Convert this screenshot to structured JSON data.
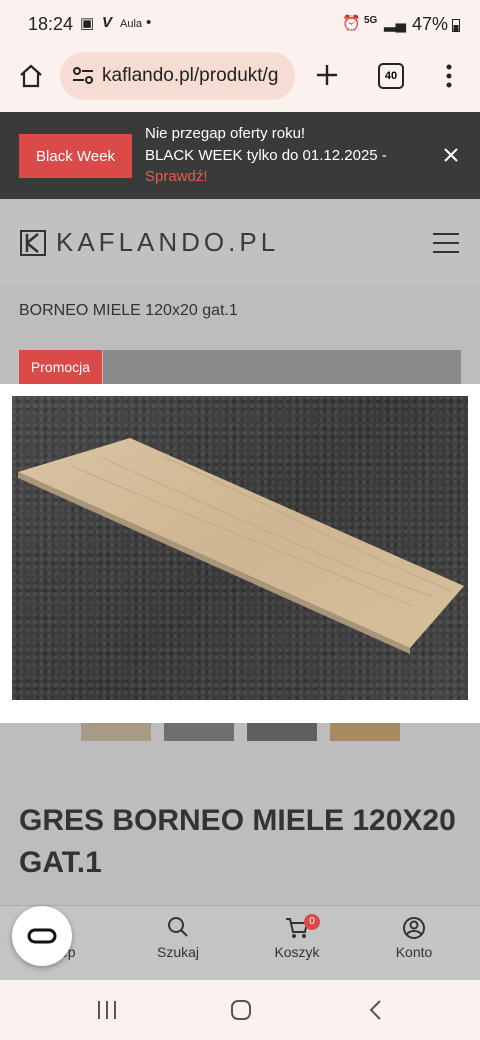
{
  "status_bar": {
    "time": "18:24",
    "network": "5G",
    "battery": "47%"
  },
  "browser": {
    "url": "kaflando.pl/produkt/g",
    "tab_count": "40"
  },
  "banner": {
    "button_label": "Black Week",
    "line1": "Nie przegap oferty roku!",
    "line2": "BLACK WEEK tylko do 01.12.2025 -",
    "cta": "Sprawdź!"
  },
  "site": {
    "logo_text": "KAFLANDO.PL",
    "breadcrumb_tail": "BORNEO MIELE 120x20 gat.1",
    "promo_label": "Promocja",
    "product_title": "GRES BORNEO MIELE 120X20 GAT.1"
  },
  "bottom_nav": [
    {
      "label": "Sklep",
      "icon": "shop-icon"
    },
    {
      "label": "Szukaj",
      "icon": "search-icon"
    },
    {
      "label": "Koszyk",
      "icon": "cart-icon",
      "badge": "0"
    },
    {
      "label": "Konto",
      "icon": "account-icon"
    }
  ]
}
